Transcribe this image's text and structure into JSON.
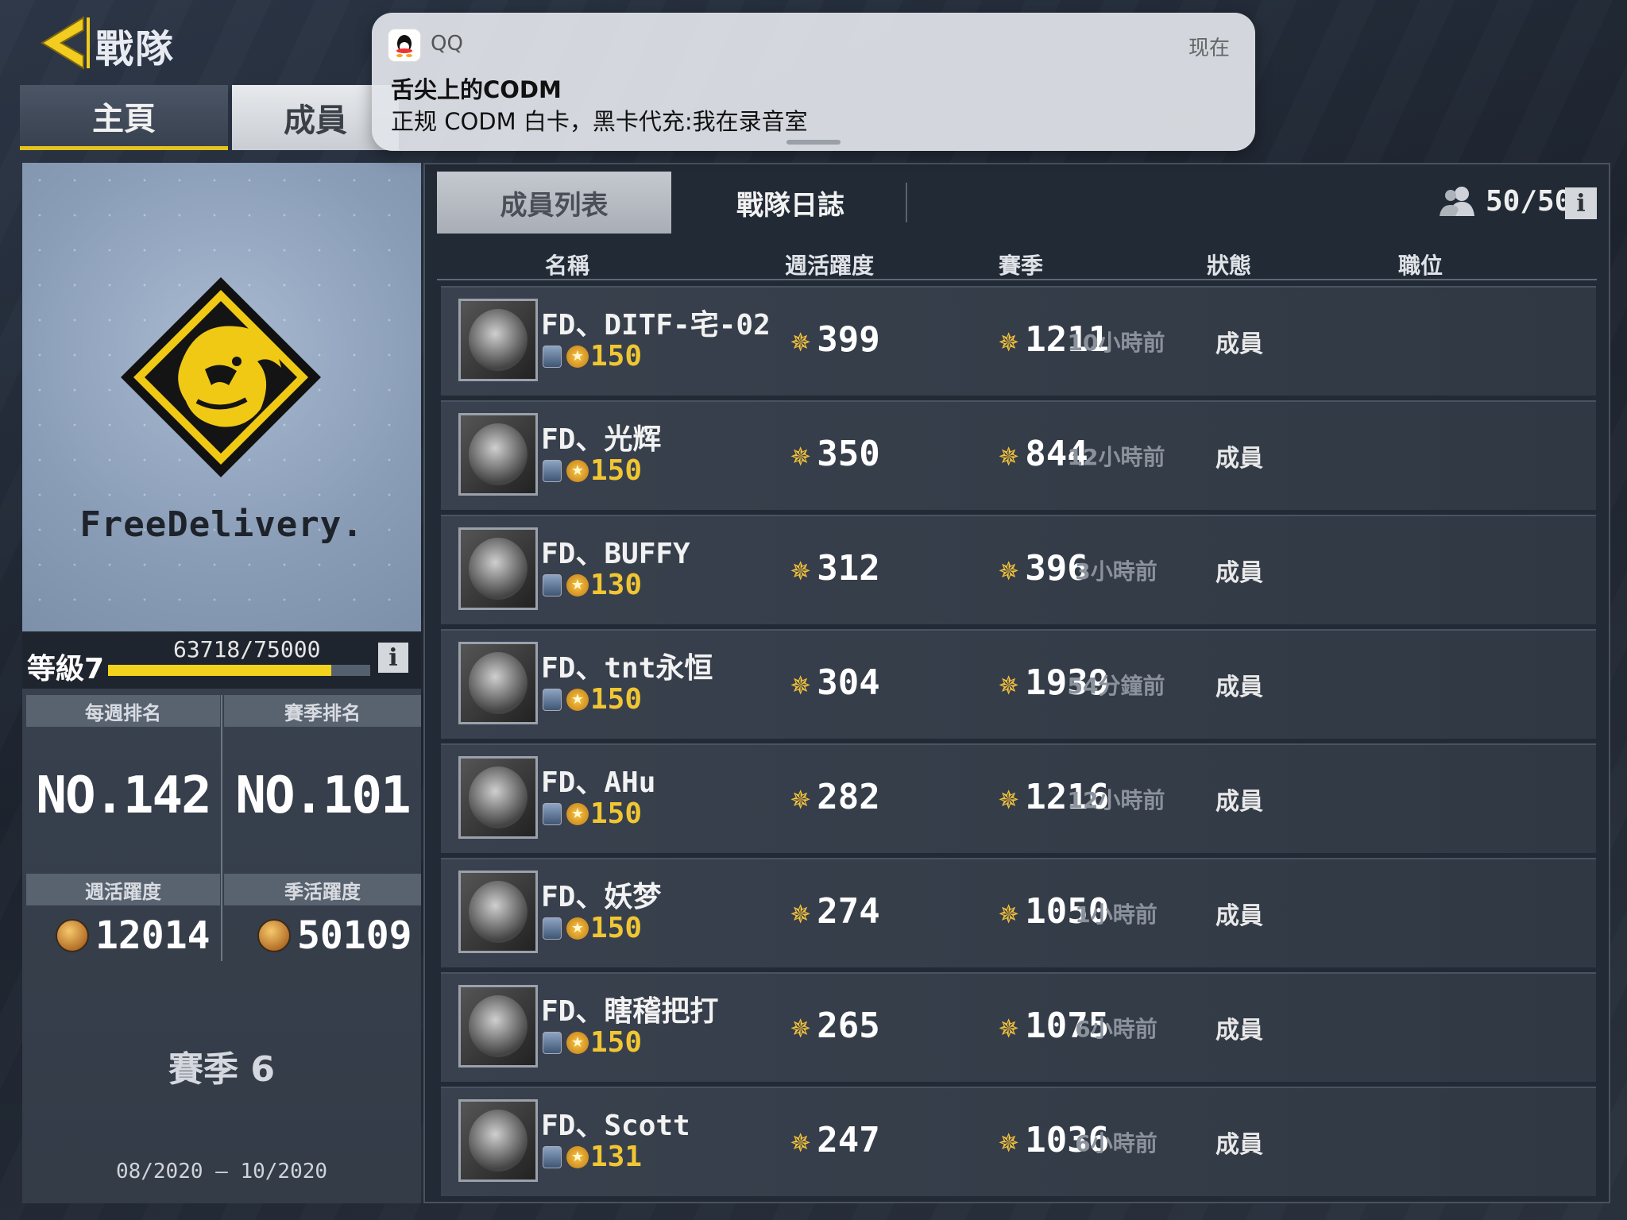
{
  "header": {
    "title": "戰隊",
    "tabs": [
      "主頁",
      "成員"
    ]
  },
  "notification": {
    "app": "QQ",
    "time": "现在",
    "title": "舌尖上的CODM",
    "body": "正规 CODM 白卡，黑卡代充:我在录音室"
  },
  "team": {
    "name": "FreeDelivery.",
    "level_label": "等級7",
    "level_progress": "63718/75000",
    "level_fraction": 0.85,
    "weekly_rank_label": "每週排名",
    "weekly_rank": "NO.142",
    "season_rank_label": "賽季排名",
    "season_rank": "NO.101",
    "weekly_activity_label": "週活躍度",
    "weekly_activity": "12014",
    "season_activity_label": "季活躍度",
    "season_activity": "50109",
    "season": "賽季 6",
    "season_dates": "08/2020 – 10/2020"
  },
  "members_panel": {
    "subtabs": [
      "成員列表",
      "戰隊日誌"
    ],
    "member_count": "50/50",
    "columns": [
      "名稱",
      "週活躍度",
      "賽季",
      "狀態",
      "職位"
    ],
    "rows": [
      {
        "name": "FD、DITF-宅-02",
        "level": "150",
        "weekly": "399",
        "season": "1211",
        "status": "10小時前",
        "role": "成員"
      },
      {
        "name": "FD、光辉",
        "level": "150",
        "weekly": "350",
        "season": "844",
        "status": "12小時前",
        "role": "成員"
      },
      {
        "name": "FD、BUFFY",
        "level": "130",
        "weekly": "312",
        "season": "396",
        "status": "3小時前",
        "role": "成員"
      },
      {
        "name": "FD、tnt永恒",
        "level": "150",
        "weekly": "304",
        "season": "1939",
        "status": "54分鐘前",
        "role": "成員"
      },
      {
        "name": "FD、AHu",
        "level": "150",
        "weekly": "282",
        "season": "1216",
        "status": "12小時前",
        "role": "成員"
      },
      {
        "name": "FD、妖梦",
        "level": "150",
        "weekly": "274",
        "season": "1050",
        "status": "1小時前",
        "role": "成員"
      },
      {
        "name": "FD、瞎稽把打",
        "level": "150",
        "weekly": "265",
        "season": "1075",
        "status": "6小時前",
        "role": "成員"
      },
      {
        "name": "FD、Scott",
        "level": "131",
        "weekly": "247",
        "season": "1036",
        "status": "6小時前",
        "role": "成員"
      }
    ]
  },
  "colors": {
    "accent": "#e6c31c",
    "gold_star": "#f4c23a"
  },
  "icons": [
    "back-arrow-icon",
    "qq-icon",
    "info-icon",
    "members-icon",
    "star-icon",
    "coin-icon",
    "rank-badge-icon",
    "team-emblem-lion"
  ]
}
